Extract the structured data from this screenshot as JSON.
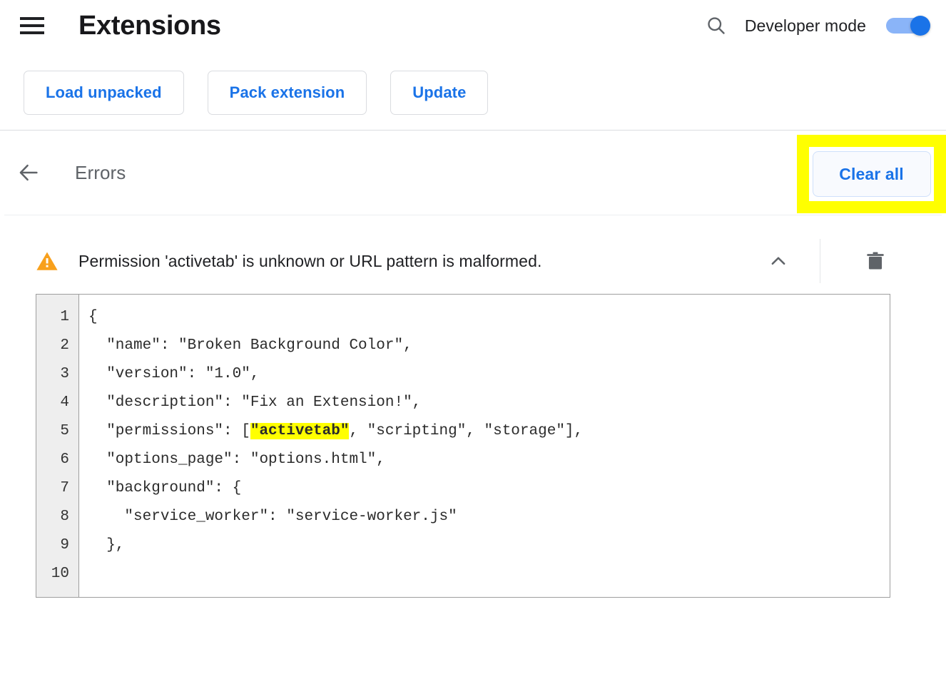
{
  "header": {
    "menu_icon": "hamburger-menu-icon",
    "title": "Extensions",
    "search_icon": "search-icon",
    "dev_mode_label": "Developer mode",
    "dev_mode_enabled": true,
    "toggle_track_color": "#8ab4f8",
    "toggle_knob_color": "#1a73e8"
  },
  "toolbar": {
    "load_unpacked_label": "Load unpacked",
    "pack_extension_label": "Pack extension",
    "update_label": "Update",
    "button_text_color": "#1a73e8"
  },
  "errors_section": {
    "back_icon": "back-arrow-icon",
    "title": "Errors",
    "clear_all_label": "Clear all",
    "highlight_color": "#ffff00"
  },
  "error_item": {
    "severity_icon": "warning-triangle-icon",
    "severity_color": "#f8a01c",
    "message": "Permission 'activetab' is unknown or URL pattern is malformed.",
    "collapse_icon": "chevron-up-icon",
    "delete_icon": "trash-icon"
  },
  "code_viewer": {
    "line_numbers": [
      "1",
      "2",
      "3",
      "4",
      "5",
      "6",
      "7",
      "8",
      "9",
      "10"
    ],
    "lines": [
      {
        "pre": "{",
        "highlight": "",
        "post": ""
      },
      {
        "pre": "  \"name\": \"Broken Background Color\",",
        "highlight": "",
        "post": ""
      },
      {
        "pre": "  \"version\": \"1.0\",",
        "highlight": "",
        "post": ""
      },
      {
        "pre": "  \"description\": \"Fix an Extension!\",",
        "highlight": "",
        "post": ""
      },
      {
        "pre": "  \"permissions\": [",
        "highlight": "\"activetab\"",
        "post": ", \"scripting\", \"storage\"],"
      },
      {
        "pre": "  \"options_page\": \"options.html\",",
        "highlight": "",
        "post": ""
      },
      {
        "pre": "  \"background\": {",
        "highlight": "",
        "post": ""
      },
      {
        "pre": "    \"service_worker\": \"service-worker.js\"",
        "highlight": "",
        "post": ""
      },
      {
        "pre": "  },",
        "highlight": "",
        "post": ""
      },
      {
        "pre": "",
        "highlight": "",
        "post": ""
      }
    ],
    "highlight_color": "#ffff00"
  }
}
